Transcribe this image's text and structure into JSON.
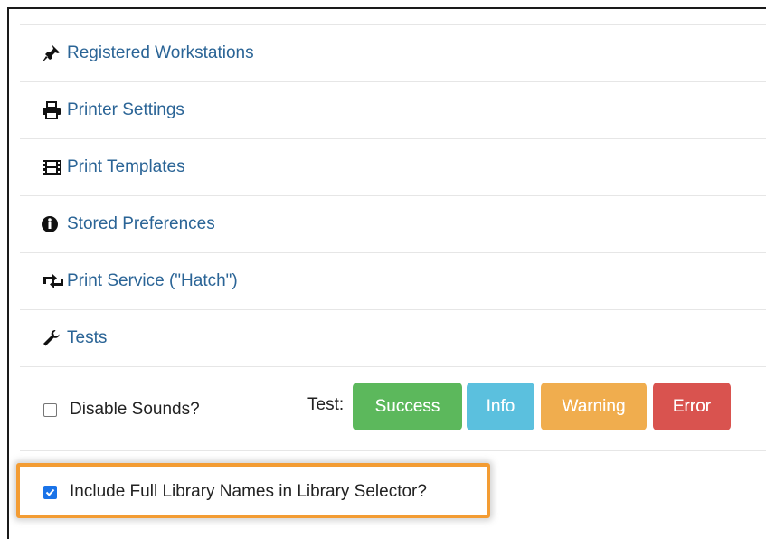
{
  "nav_items": [
    {
      "label": "Registered Workstations",
      "icon": "pushpin-icon"
    },
    {
      "label": "Printer Settings",
      "icon": "print-icon"
    },
    {
      "label": "Print Templates",
      "icon": "film-icon"
    },
    {
      "label": "Stored Preferences",
      "icon": "info-sign-icon"
    },
    {
      "label": "Print Service (\"Hatch\")",
      "icon": "transfer-icon"
    },
    {
      "label": "Tests",
      "icon": "wrench-icon"
    }
  ],
  "sounds": {
    "disable_label": "Disable Sounds?",
    "disable_checked": false,
    "test_label": "Test:",
    "buttons": {
      "success": "Success",
      "info": "Info",
      "warning": "Warning",
      "error": "Error"
    }
  },
  "library_names": {
    "label": "Include Full Library Names in Library Selector?",
    "checked": true
  },
  "colors": {
    "link": "#2a6496",
    "success": "#5cb85c",
    "info": "#5bc0de",
    "warning": "#f0ad4e",
    "error": "#d9534f",
    "highlight": "#f39c33"
  }
}
